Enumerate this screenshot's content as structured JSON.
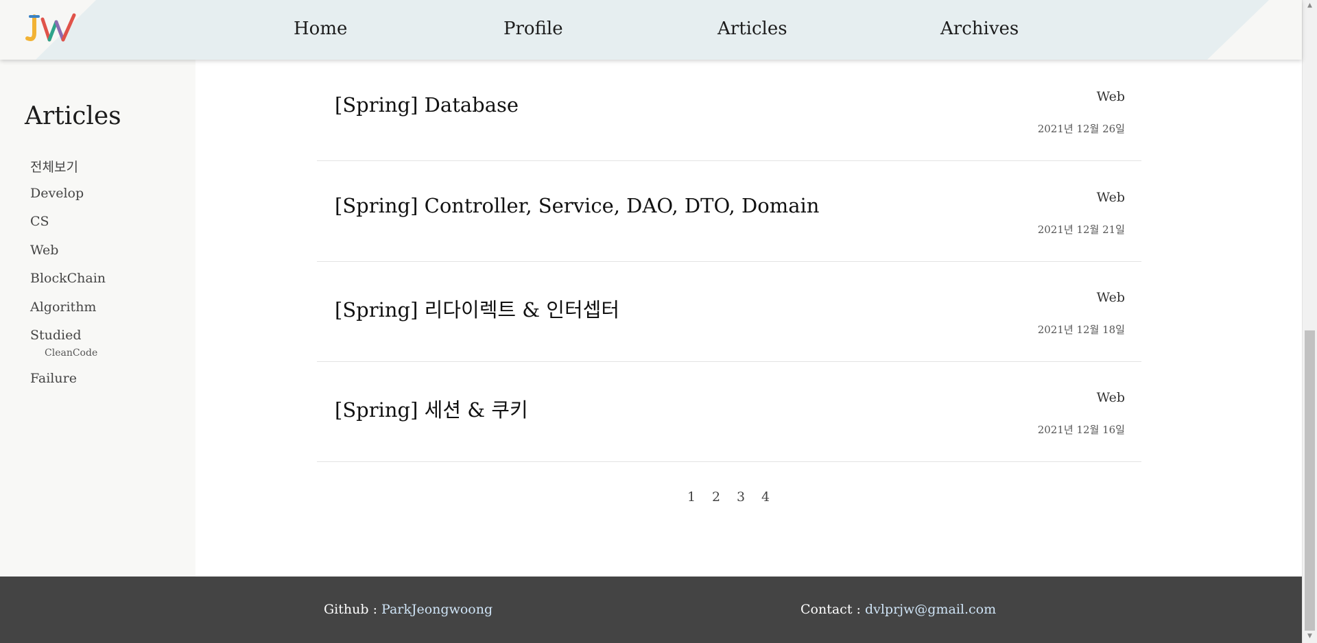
{
  "header": {
    "nav": [
      "Home",
      "Profile",
      "Articles",
      "Archives"
    ]
  },
  "sidebar": {
    "title": "Articles",
    "categories": [
      "전체보기",
      "Develop",
      "CS",
      "Web",
      "BlockChain",
      "Algorithm",
      "Studied",
      "Failure"
    ],
    "subcategories": {
      "studied": [
        "CleanCode"
      ]
    }
  },
  "articles": [
    {
      "title": "[Spring] Database",
      "category": "Web",
      "date": "2021년 12월 26일"
    },
    {
      "title": "[Spring] Controller, Service, DAO, DTO, Domain",
      "category": "Web",
      "date": "2021년 12월 21일"
    },
    {
      "title": "[Spring] 리다이렉트 & 인터셉터",
      "category": "Web",
      "date": "2021년 12월 18일"
    },
    {
      "title": "[Spring] 세션 & 쿠키",
      "category": "Web",
      "date": "2021년 12월 16일"
    }
  ],
  "pagination": [
    "1",
    "2",
    "3",
    "4"
  ],
  "footer": {
    "github_label": "Github : ",
    "github_link": "ParkJeongwoong",
    "contact_label": "Contact : ",
    "contact_link": "dvlprjw@gmail.com"
  },
  "icons": {
    "logo": "jw-logo-icon",
    "scroll_up": "arrow-up-icon",
    "scroll_down": "arrow-down-icon"
  },
  "colors": {
    "header_band": "#e6eef0",
    "footer_bg": "#444444",
    "footer_link": "#cfe4f6"
  }
}
